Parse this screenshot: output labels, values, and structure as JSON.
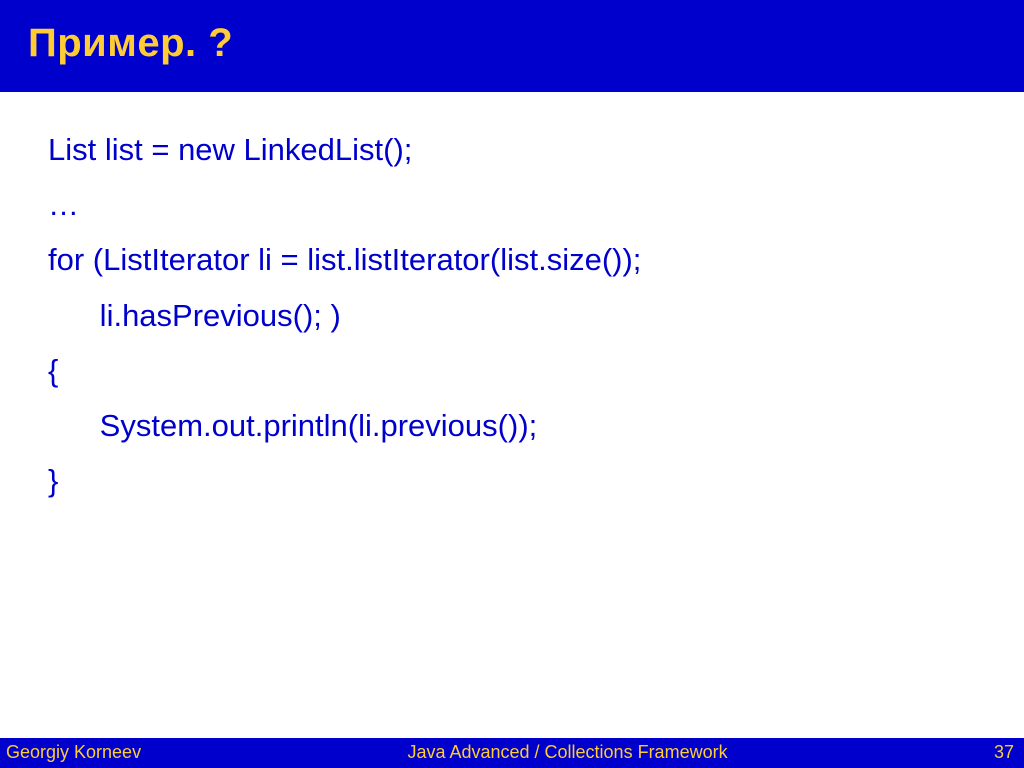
{
  "title": "Пример. ?",
  "code": {
    "l1": "List list = new LinkedList();",
    "l2": "…",
    "l3": "for (ListIterator li = list.listIterator(list.size()); ",
    "l4": "      li.hasPrevious(); )",
    "l5": "{",
    "l6": "      System.out.println(li.previous());",
    "l7": "}"
  },
  "footer": {
    "author": "Georgiy Korneev",
    "course": "Java Advanced / Collections Framework",
    "page": "37"
  },
  "colors": {
    "bar_bg": "#0000cc",
    "bar_fg": "#ffcc33",
    "code_fg": "#0000cc"
  }
}
